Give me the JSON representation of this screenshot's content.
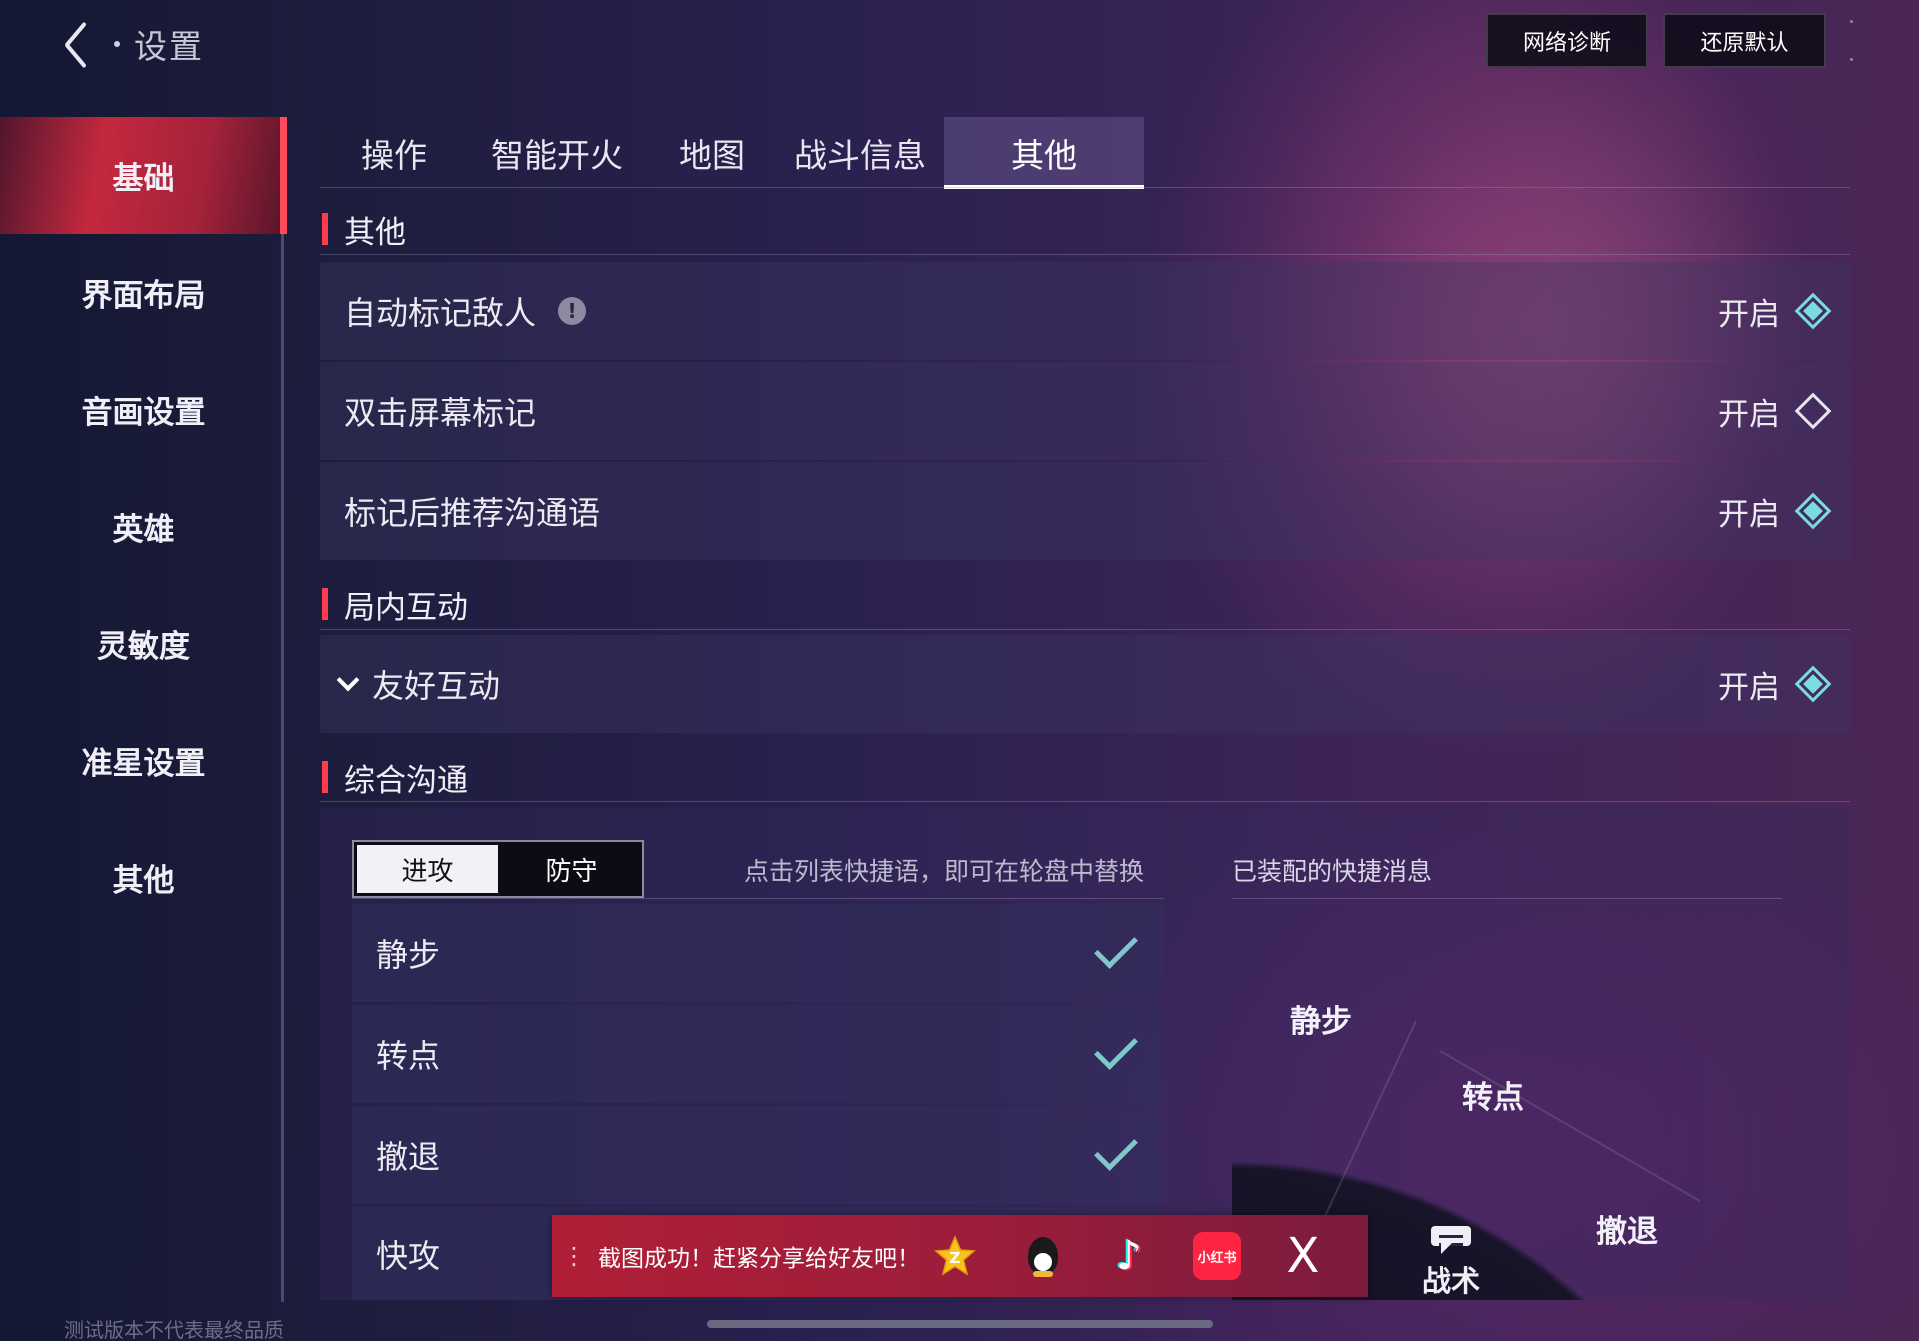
{
  "header": {
    "title": "设置",
    "buttons": {
      "network": "网络诊断",
      "reset": "还原默认"
    }
  },
  "sidebar": {
    "items": [
      {
        "label": "基础",
        "active": true
      },
      {
        "label": "界面布局"
      },
      {
        "label": "音画设置"
      },
      {
        "label": "英雄"
      },
      {
        "label": "灵敏度"
      },
      {
        "label": "准星设置"
      },
      {
        "label": "其他"
      }
    ]
  },
  "tabs": [
    {
      "label": "操作"
    },
    {
      "label": "智能开火"
    },
    {
      "label": "地图"
    },
    {
      "label": "战斗信息"
    },
    {
      "label": "其他",
      "active": true
    }
  ],
  "sections": {
    "other": {
      "title": "其他",
      "rows": [
        {
          "label": "自动标记敌人",
          "value": "开启",
          "enabled": true,
          "has_info": true
        },
        {
          "label": "双击屏幕标记",
          "value": "开启",
          "enabled": false
        },
        {
          "label": "标记后推荐沟通语",
          "value": "开启",
          "enabled": true
        }
      ]
    },
    "interaction": {
      "title": "局内互动",
      "rows": [
        {
          "label": "友好互动",
          "value": "开启",
          "enabled": true,
          "expandable": true
        }
      ]
    },
    "comm": {
      "title": "综合沟通",
      "segments": [
        "进攻",
        "防守"
      ],
      "selected_segment": "进攻",
      "hint": "点击列表快捷语，即可在轮盘中替换",
      "equipped_title": "已装配的快捷消息",
      "quick_list": [
        {
          "label": "静步",
          "checked": true
        },
        {
          "label": "转点",
          "checked": true
        },
        {
          "label": "撤退",
          "checked": true
        },
        {
          "label": "快攻",
          "checked": false
        }
      ],
      "wheel_items": [
        "静步",
        "转点",
        "撤退"
      ],
      "tactic_label": "战术"
    }
  },
  "toast": {
    "text": "截图成功！赶紧分享给好友吧！",
    "share_targets": [
      "qzone",
      "qq",
      "douyin",
      "xiaohongshu",
      "x"
    ],
    "xhs_label": "小红书",
    "x_label": "X"
  },
  "watermark": "测试版本不代表最终品质",
  "colors": {
    "accent_red": "#ff3b52",
    "toggle_on": "#7adbe0",
    "check": "#7fc7c9"
  }
}
